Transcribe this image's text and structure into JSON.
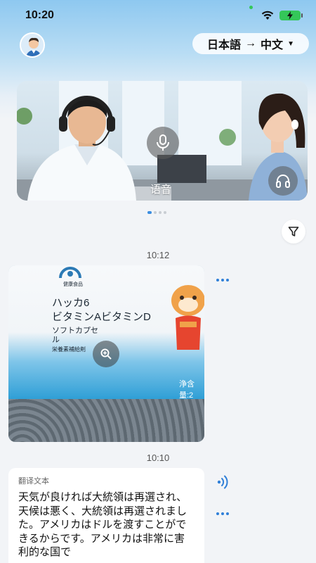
{
  "status_bar": {
    "time": "10:20"
  },
  "header": {
    "language_pair": {
      "source": "日本語",
      "arrow": "→",
      "target": "中文"
    }
  },
  "banner": {
    "label": "语音"
  },
  "pager": {
    "pages": 4,
    "active_index": 0
  },
  "conversation": {
    "timestamps": [
      "10:12",
      "10:10"
    ],
    "image_message": {
      "product_lines": [
        "健康食品",
        "ハッカ6",
        "ビタミンAビタミンD",
        "ソフトカプセ",
        "ル",
        "栄養素補給剤",
        "浄含量:2"
      ]
    },
    "text_message": {
      "label": "翻译文本",
      "body": "天気が良ければ大統領は再選され、 天候は悪く、大統領は再選されました。アメリカはドルを渡すことができるからです。アメリカは非常に害利的な国で"
    }
  },
  "colors": {
    "accent": "#2f7fd8",
    "battery": "#34c759",
    "background": "#f2f4f7"
  },
  "icons": [
    "wifi-icon",
    "battery-icon",
    "filter-icon",
    "microphone-icon",
    "headset-icon",
    "zoom-icon",
    "speaker-icon",
    "more-icon"
  ]
}
